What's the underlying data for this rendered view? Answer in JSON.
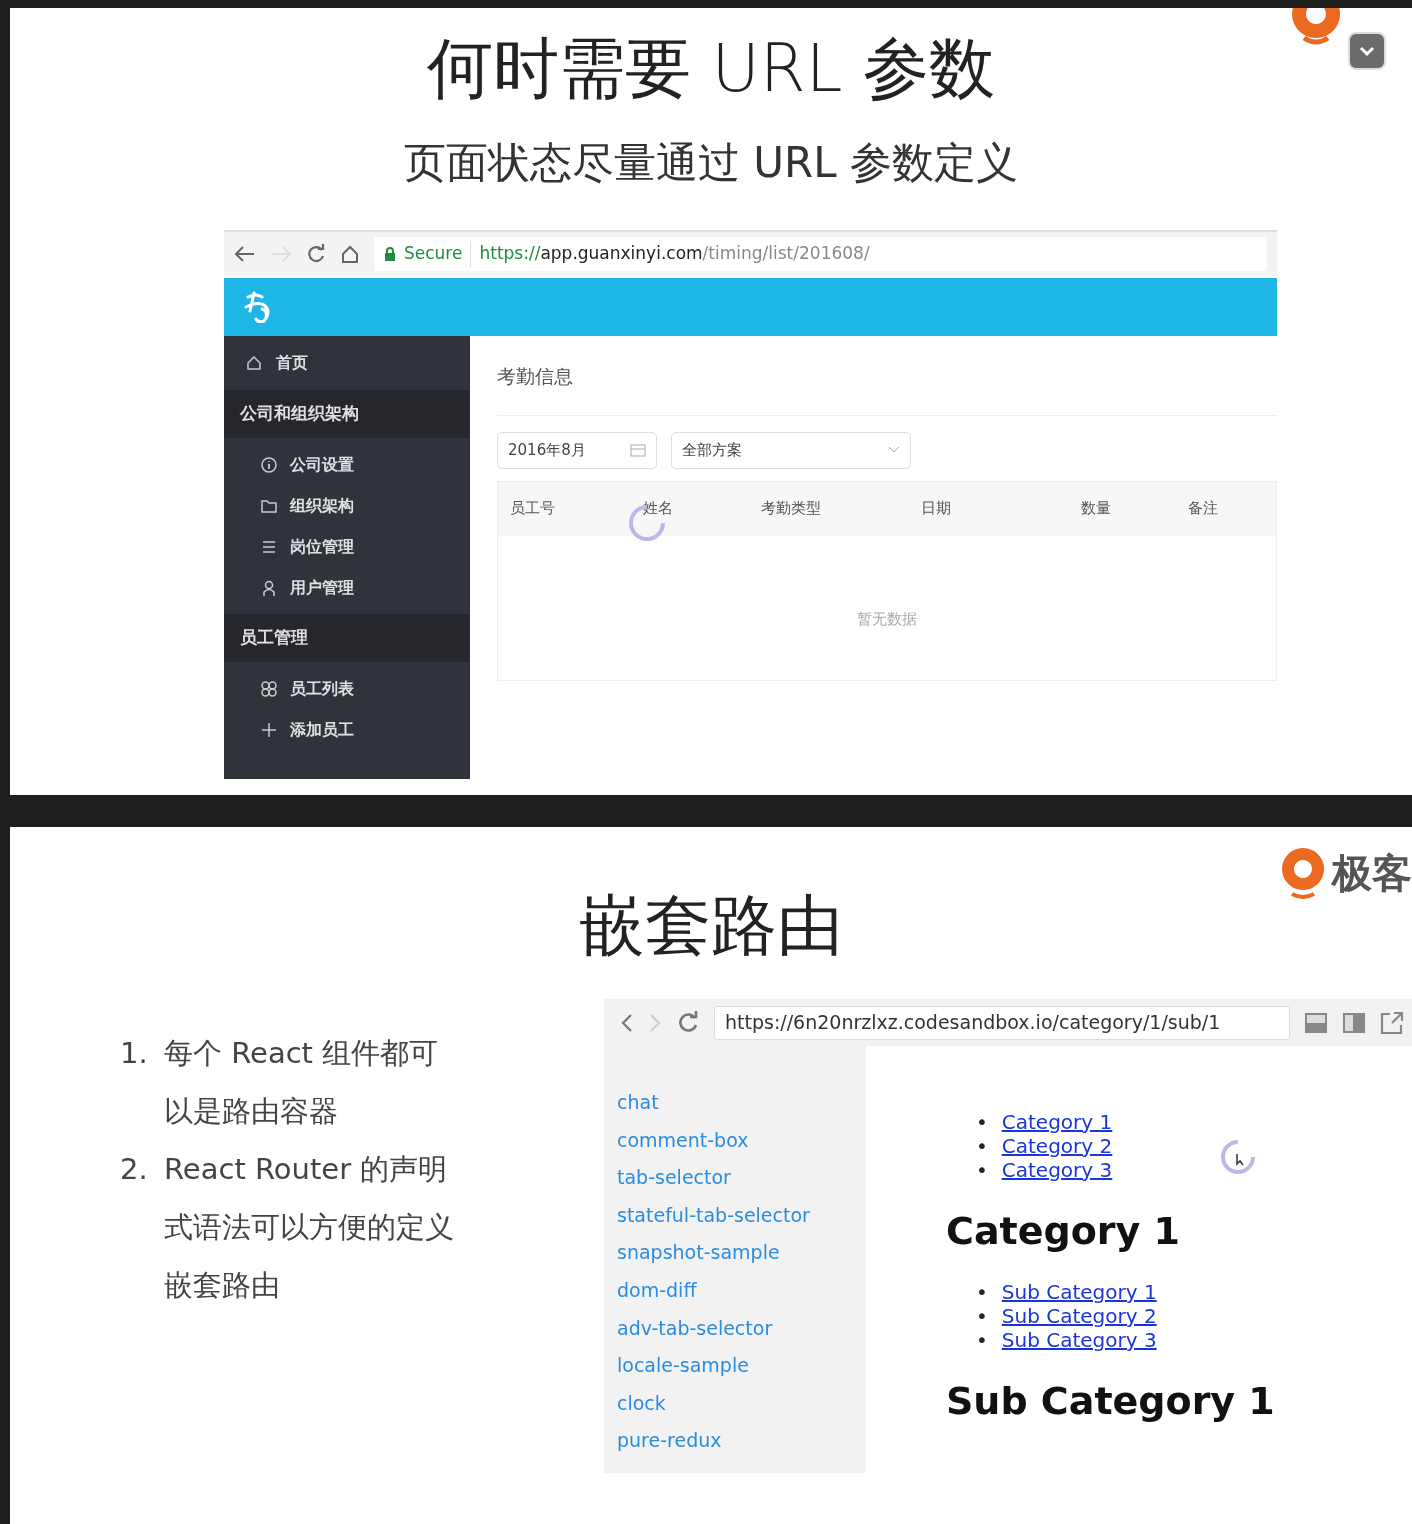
{
  "top_slide": {
    "title": "何时需要 URL 参数",
    "subtitle": "页面状态尽量通过 URL 参数定义",
    "browser": {
      "back_disabled": false,
      "forward_disabled": true,
      "secure_label": "Secure",
      "url_scheme": "https://",
      "url_host": "app.guanxinyi.com",
      "url_path": "/timing/list/201608/"
    },
    "app": {
      "sidebar": [
        {
          "kind": "item",
          "label": "首页"
        },
        {
          "kind": "group",
          "label": "公司和组织架构"
        },
        {
          "kind": "subitem",
          "label": "公司设置"
        },
        {
          "kind": "subitem",
          "label": "组织架构"
        },
        {
          "kind": "subitem",
          "label": "岗位管理"
        },
        {
          "kind": "subitem",
          "label": "用户管理"
        },
        {
          "kind": "group",
          "label": "员工管理"
        },
        {
          "kind": "subitem",
          "label": "员工列表"
        },
        {
          "kind": "subitem",
          "label": "添加员工"
        }
      ],
      "page_title": "考勤信息",
      "date_value": "2016年8月",
      "plan_value": "全部方案",
      "columns": [
        "员工号",
        "姓名",
        "考勤类型",
        "日期",
        "数量",
        "备注"
      ],
      "empty_text": "暂无数据"
    }
  },
  "bottom_slide": {
    "logo_text": "极客",
    "title": "嵌套路由",
    "points": [
      {
        "number": "1.",
        "text": "每个 React 组件都可以是路由容器"
      },
      {
        "number": "2.",
        "text": "React Router 的声明式语法可以方便的定义嵌套路由"
      }
    ],
    "browser": {
      "back_disabled": false,
      "forward_disabled": true,
      "url": "https://6n20nrzlxz.codesandbox.io/category/1/sub/1",
      "sidebar_links": [
        "chat",
        "comment-box",
        "tab-selector",
        "stateful-tab-selector",
        "snapshot-sample",
        "dom-diff",
        "adv-tab-selector",
        "locale-sample",
        "clock",
        "pure-redux"
      ],
      "category_links": [
        {
          "bullet": "•",
          "label": "Category 1"
        },
        {
          "bullet": "•",
          "label": "Category 2"
        },
        {
          "bullet": "•",
          "label": "Category 3"
        }
      ],
      "category_heading": "Category 1",
      "sub_links": [
        {
          "bullet": "•",
          "label": "Sub Category 1"
        },
        {
          "bullet": "•",
          "label": "Sub Category 2"
        },
        {
          "bullet": "•",
          "label": "Sub Category 3"
        }
      ],
      "sub_heading": "Sub Category 1"
    }
  }
}
